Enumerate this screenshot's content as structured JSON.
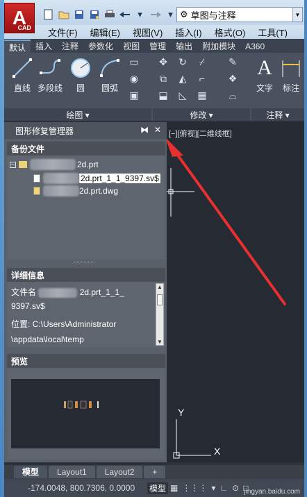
{
  "app": {
    "logo_letter": "A",
    "logo_sub": "CAD"
  },
  "quick_access": {
    "icons": [
      "new-icon",
      "open-icon",
      "save-icon",
      "save-as-icon",
      "print-icon",
      "undo-icon",
      "redo-icon"
    ]
  },
  "workspace": {
    "value": "草图与注释"
  },
  "menubar": {
    "items": [
      "文件(F)",
      "编辑(E)",
      "视图(V)",
      "插入(I)",
      "格式(O)",
      "工具(T)"
    ]
  },
  "ribbon_tabs": {
    "items": [
      "默认",
      "插入",
      "注释",
      "参数化",
      "视图",
      "管理",
      "输出",
      "附加模块",
      "A360"
    ]
  },
  "ribbon": {
    "draw_tools": [
      "直线",
      "多段线",
      "圆",
      "圆弧"
    ],
    "draw_group": "绘图 ▾",
    "modify_group": "修改 ▾",
    "annotate_tools": [
      "文字",
      "标注"
    ],
    "annotate_group": "注释 ▾"
  },
  "palette": {
    "title": "图形修复管理器",
    "backup_title": "备份文件",
    "tree": [
      {
        "label": "2d.prt"
      },
      {
        "label": "2d.prt_1_1_9397.sv$"
      },
      {
        "label": "2d.prt.dwg"
      }
    ],
    "details_title": "详细信息",
    "details_lines": [
      "文件名",
      "2d.prt_1_1_",
      "9397.sv$",
      "位置: C:\\Users\\Administrator",
      "\\appdata\\local\\temp"
    ],
    "preview_title": "预览"
  },
  "canvas": {
    "viewport_label": "[−][俯视][二维线框]",
    "axis_y": "Y",
    "axis_x": "X"
  },
  "layout_tabs": [
    "模型",
    "Layout1",
    "Layout2",
    "+"
  ],
  "status": {
    "coords": "-174.0048, 800.7306, 0.0000",
    "model": "模型"
  },
  "watermark": "jingyan.baidu.com",
  "colors": {
    "annotation_arrow": "#e83030",
    "autocad_red": "#c81e1e"
  }
}
